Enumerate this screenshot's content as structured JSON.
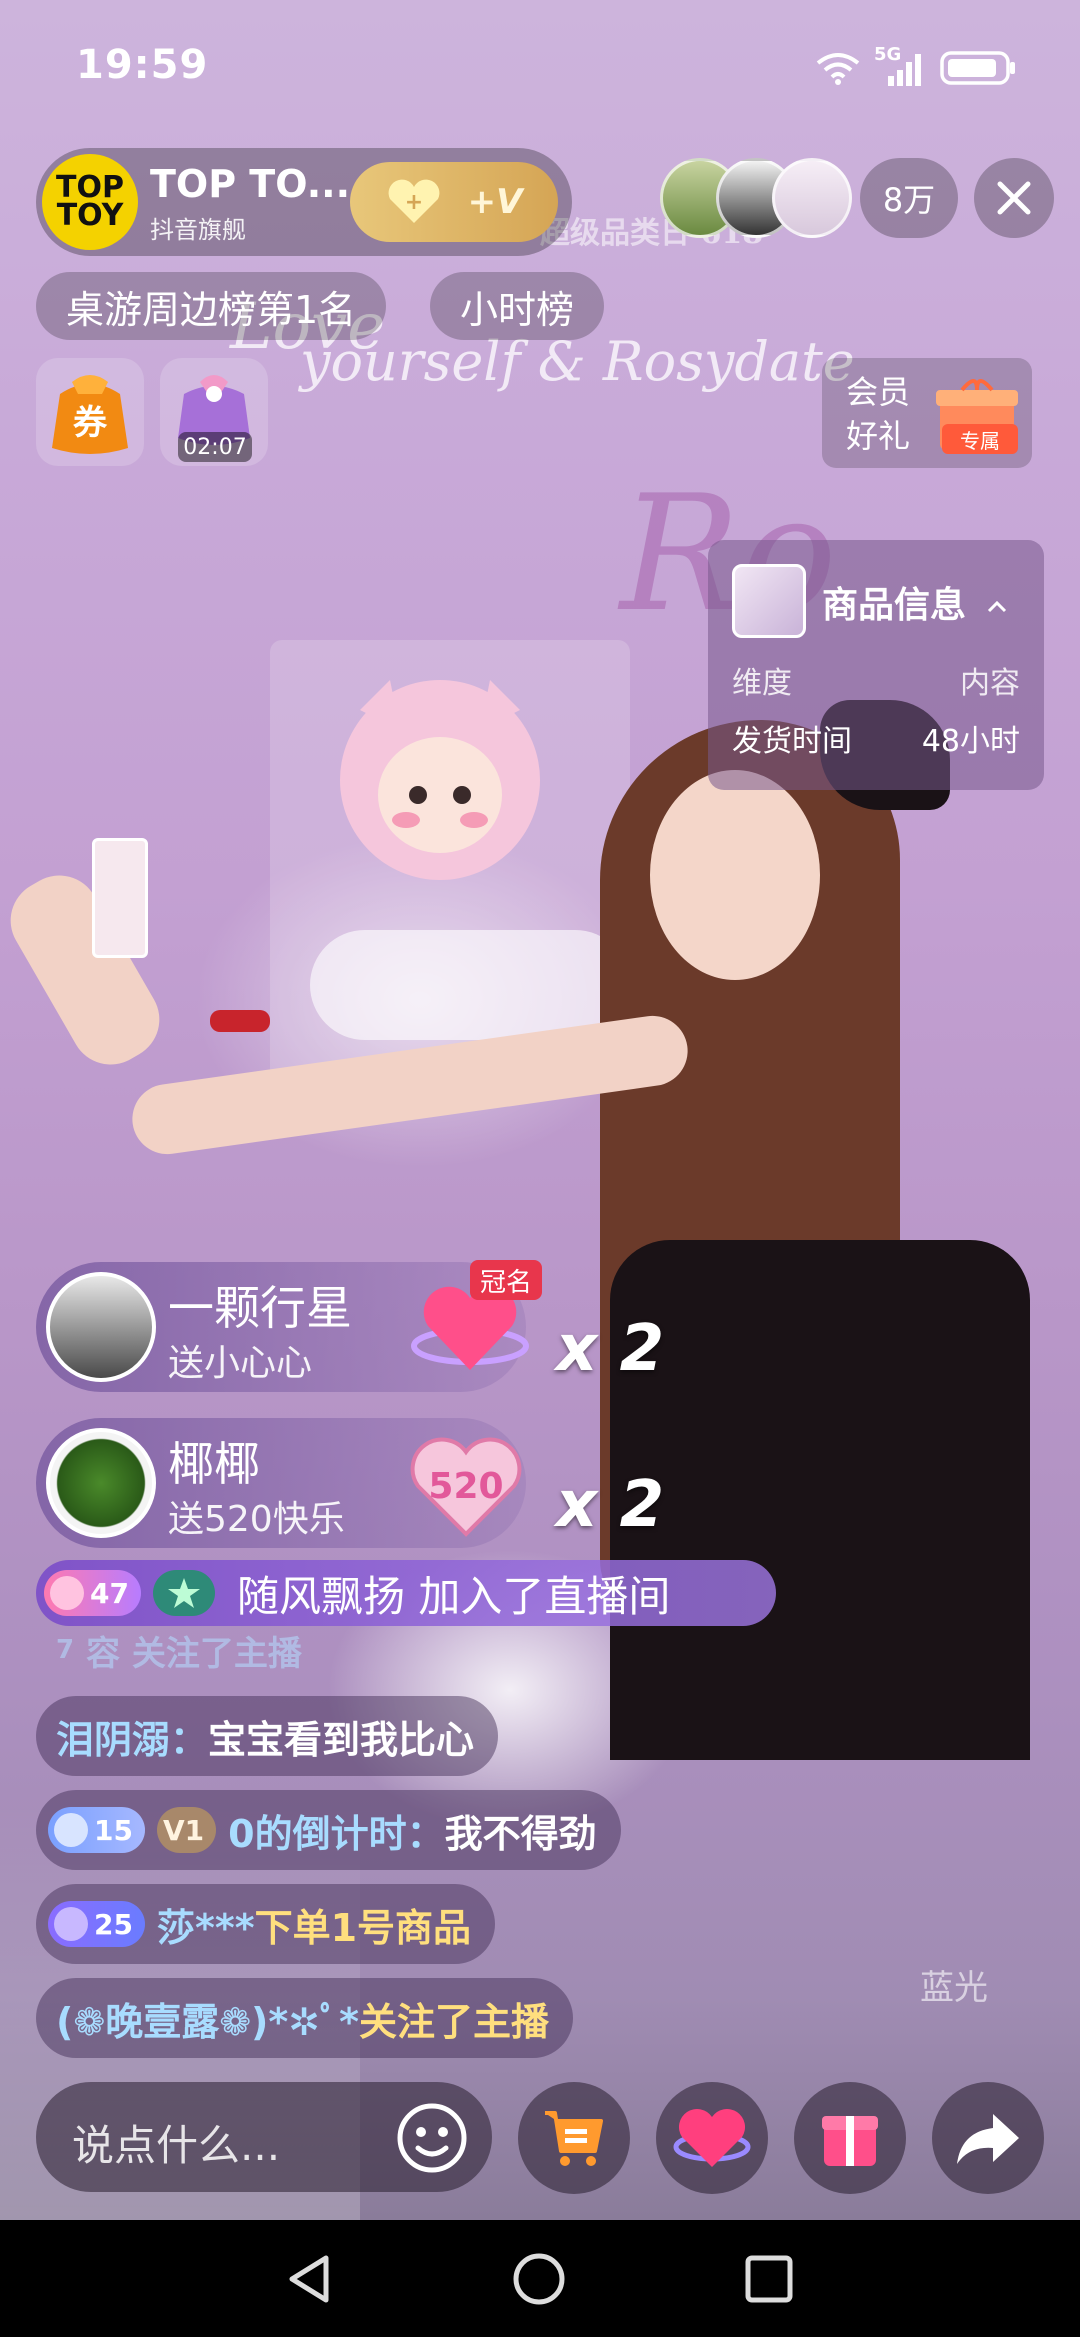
{
  "status_bar": {
    "time": "19:59",
    "network": "5G"
  },
  "host": {
    "avatar_text_1": "TOP",
    "avatar_text_2": "TOY",
    "name": "TOP TO...",
    "subtitle": "抖音旗舰",
    "follow_plus": "+",
    "follow_v": "+V"
  },
  "viewers": {
    "count": "8万"
  },
  "rank_tags": [
    "桌游周边榜第1名",
    "小时榜"
  ],
  "coupon": {
    "label": "券"
  },
  "lucky_bag": {
    "timer": "02:07"
  },
  "member_gift": {
    "line1": "会员",
    "line2": "好礼",
    "badge": "专属"
  },
  "product_info": {
    "title": "商品信息",
    "header_key": "维度",
    "header_value": "内容",
    "row_key": "发货时间",
    "row_value": "48小时"
  },
  "gifts": [
    {
      "name": "一颗行星",
      "desc": "送小心心",
      "count": "x 2",
      "badge": "冠名"
    },
    {
      "name": "椰椰",
      "desc": "送520快乐",
      "count": "x 2",
      "icon_text": "520"
    }
  ],
  "join_message": {
    "level": "47",
    "text": "随风飘扬 加入了直播间"
  },
  "fading_message": {
    "level": "7",
    "text": "容 关注了主播"
  },
  "chat": [
    {
      "user": "泪阴溺：",
      "text": "宝宝看到我比心"
    },
    {
      "level": "15",
      "sub_level": "V1",
      "user": "0的倒计时：",
      "text": "我不得劲"
    },
    {
      "level": "25",
      "user": "莎***",
      "text": " 下单1号商品"
    },
    {
      "user": "(❁晚壹露❁)*✲ﾟ*",
      "text": " 关注了主播"
    }
  ],
  "comment": {
    "placeholder": "说点什么..."
  },
  "background": {
    "banner_text": "超级品类日",
    "banner_num": "618",
    "script_1": "Love",
    "script_2": "yourself & Rosydate",
    "watermark": "蓝光"
  },
  "colors": {
    "gold": "#e8c77a",
    "chat_user": "#a8dcff",
    "join_bar": "#7d50c8",
    "badge_red": "#e8364c"
  }
}
